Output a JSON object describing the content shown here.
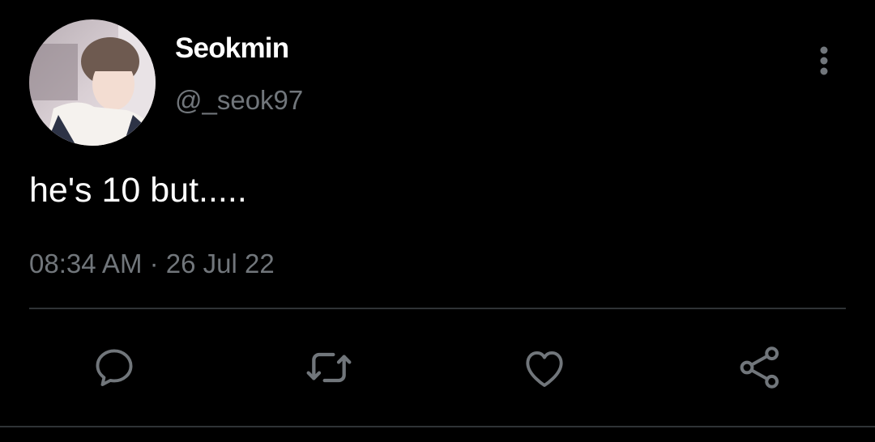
{
  "tweet": {
    "display_name": "Seokmin",
    "handle": "@_seok97",
    "text": "he's 10 but.....",
    "timestamp": "08:34 AM · 26 Jul 22"
  },
  "actions": [
    {
      "icon": "reply-icon"
    },
    {
      "icon": "retweet-icon"
    },
    {
      "icon": "like-icon"
    },
    {
      "icon": "share-icon"
    }
  ],
  "colors": {
    "background": "#000000",
    "primary_text": "#ffffff",
    "secondary_text": "#71767b",
    "divider": "#2f3336"
  }
}
